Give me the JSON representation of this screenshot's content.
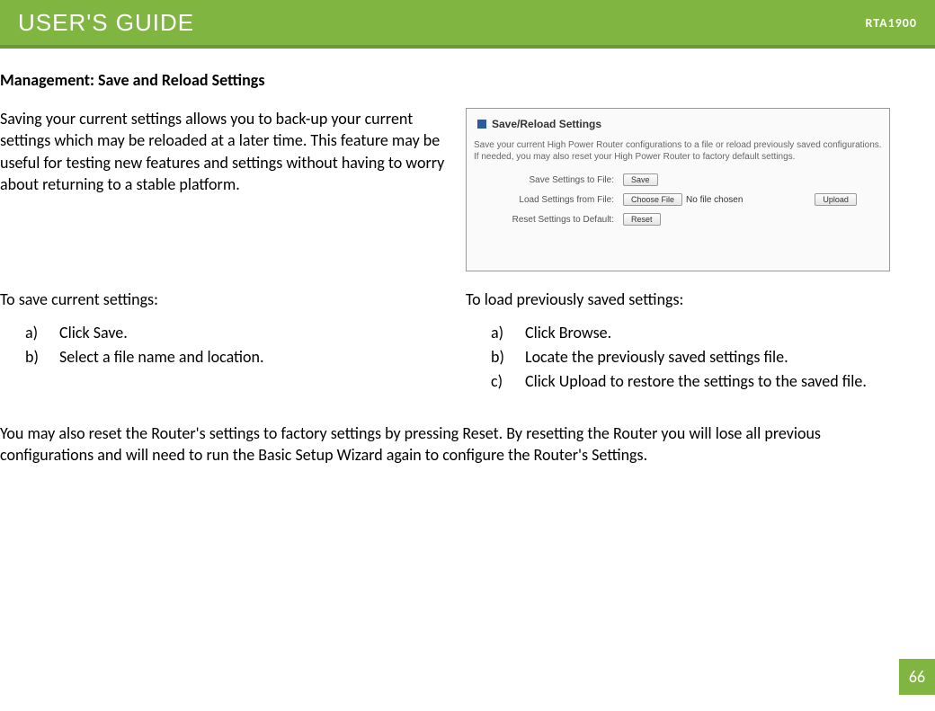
{
  "header": {
    "title": "USER'S GUIDE",
    "model": "RTA1900"
  },
  "section_title": "Management: Save and Reload Settings",
  "intro": "Saving your current settings allows you to back-up your current settings which may be reloaded at a later time. This feature may be useful for testing new features and settings without having to worry about returning to a stable platform.",
  "screenshot": {
    "title": "Save/Reload Settings",
    "description": "Save your current High Power Router configurations to a file or reload previously saved configurations. If needed, you may also reset your High Power Router to factory default settings.",
    "rows": {
      "save": {
        "label": "Save Settings to File:",
        "button": "Save"
      },
      "load": {
        "label": "Load Settings from File:",
        "choose_button": "Choose File",
        "file_text": "No file chosen",
        "upload_button": "Upload"
      },
      "reset": {
        "label": "Reset Settings to Default:",
        "button": "Reset"
      }
    }
  },
  "save_section": {
    "heading": "To save current settings:",
    "items": [
      {
        "marker": "a)",
        "text": "Click Save."
      },
      {
        "marker": "b)",
        "text": "Select a file name and location."
      }
    ]
  },
  "load_section": {
    "heading": "To load previously saved settings:",
    "items": [
      {
        "marker": "a)",
        "text": "Click Browse."
      },
      {
        "marker": "b)",
        "text": "Locate the previously saved settings file."
      },
      {
        "marker": "c)",
        "text": "Click Upload to restore the settings to the saved file."
      }
    ]
  },
  "closing": "You may also reset the Router's settings to factory settings by pressing Reset.  By resetting the Router you will lose all previous configurations and will need to run the Basic Setup Wizard again to configure the Router's Settings.",
  "page_number": "66"
}
